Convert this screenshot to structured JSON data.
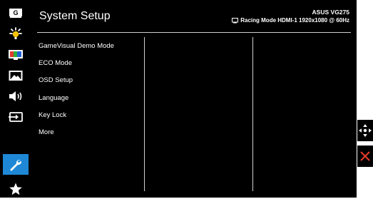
{
  "header": {
    "title": "System Setup",
    "model": "ASUS VG275",
    "mode": "Racing Mode HDMI-1 1920x1080 @ 60Hz"
  },
  "sidebar": {
    "items": [
      {
        "icon": "gamevisual-icon",
        "label": "G"
      },
      {
        "icon": "brightness-icon"
      },
      {
        "icon": "color-icon"
      },
      {
        "icon": "image-icon"
      },
      {
        "icon": "sound-icon"
      },
      {
        "icon": "input-select-icon"
      },
      {
        "icon": "wrench-icon",
        "active": true
      },
      {
        "icon": "star-icon"
      }
    ]
  },
  "menu": {
    "items": [
      "GameVisual Demo Mode",
      "ECO Mode",
      "OSD Setup",
      "Language",
      "Key Lock",
      "More"
    ]
  },
  "controls": {
    "navigate_icon": "move-arrows-icon",
    "exit_icon": "close-icon"
  },
  "colors": {
    "background": "#000000",
    "accent": "#1e88d6",
    "text": "#ffffff",
    "close": "#e23a2b"
  }
}
